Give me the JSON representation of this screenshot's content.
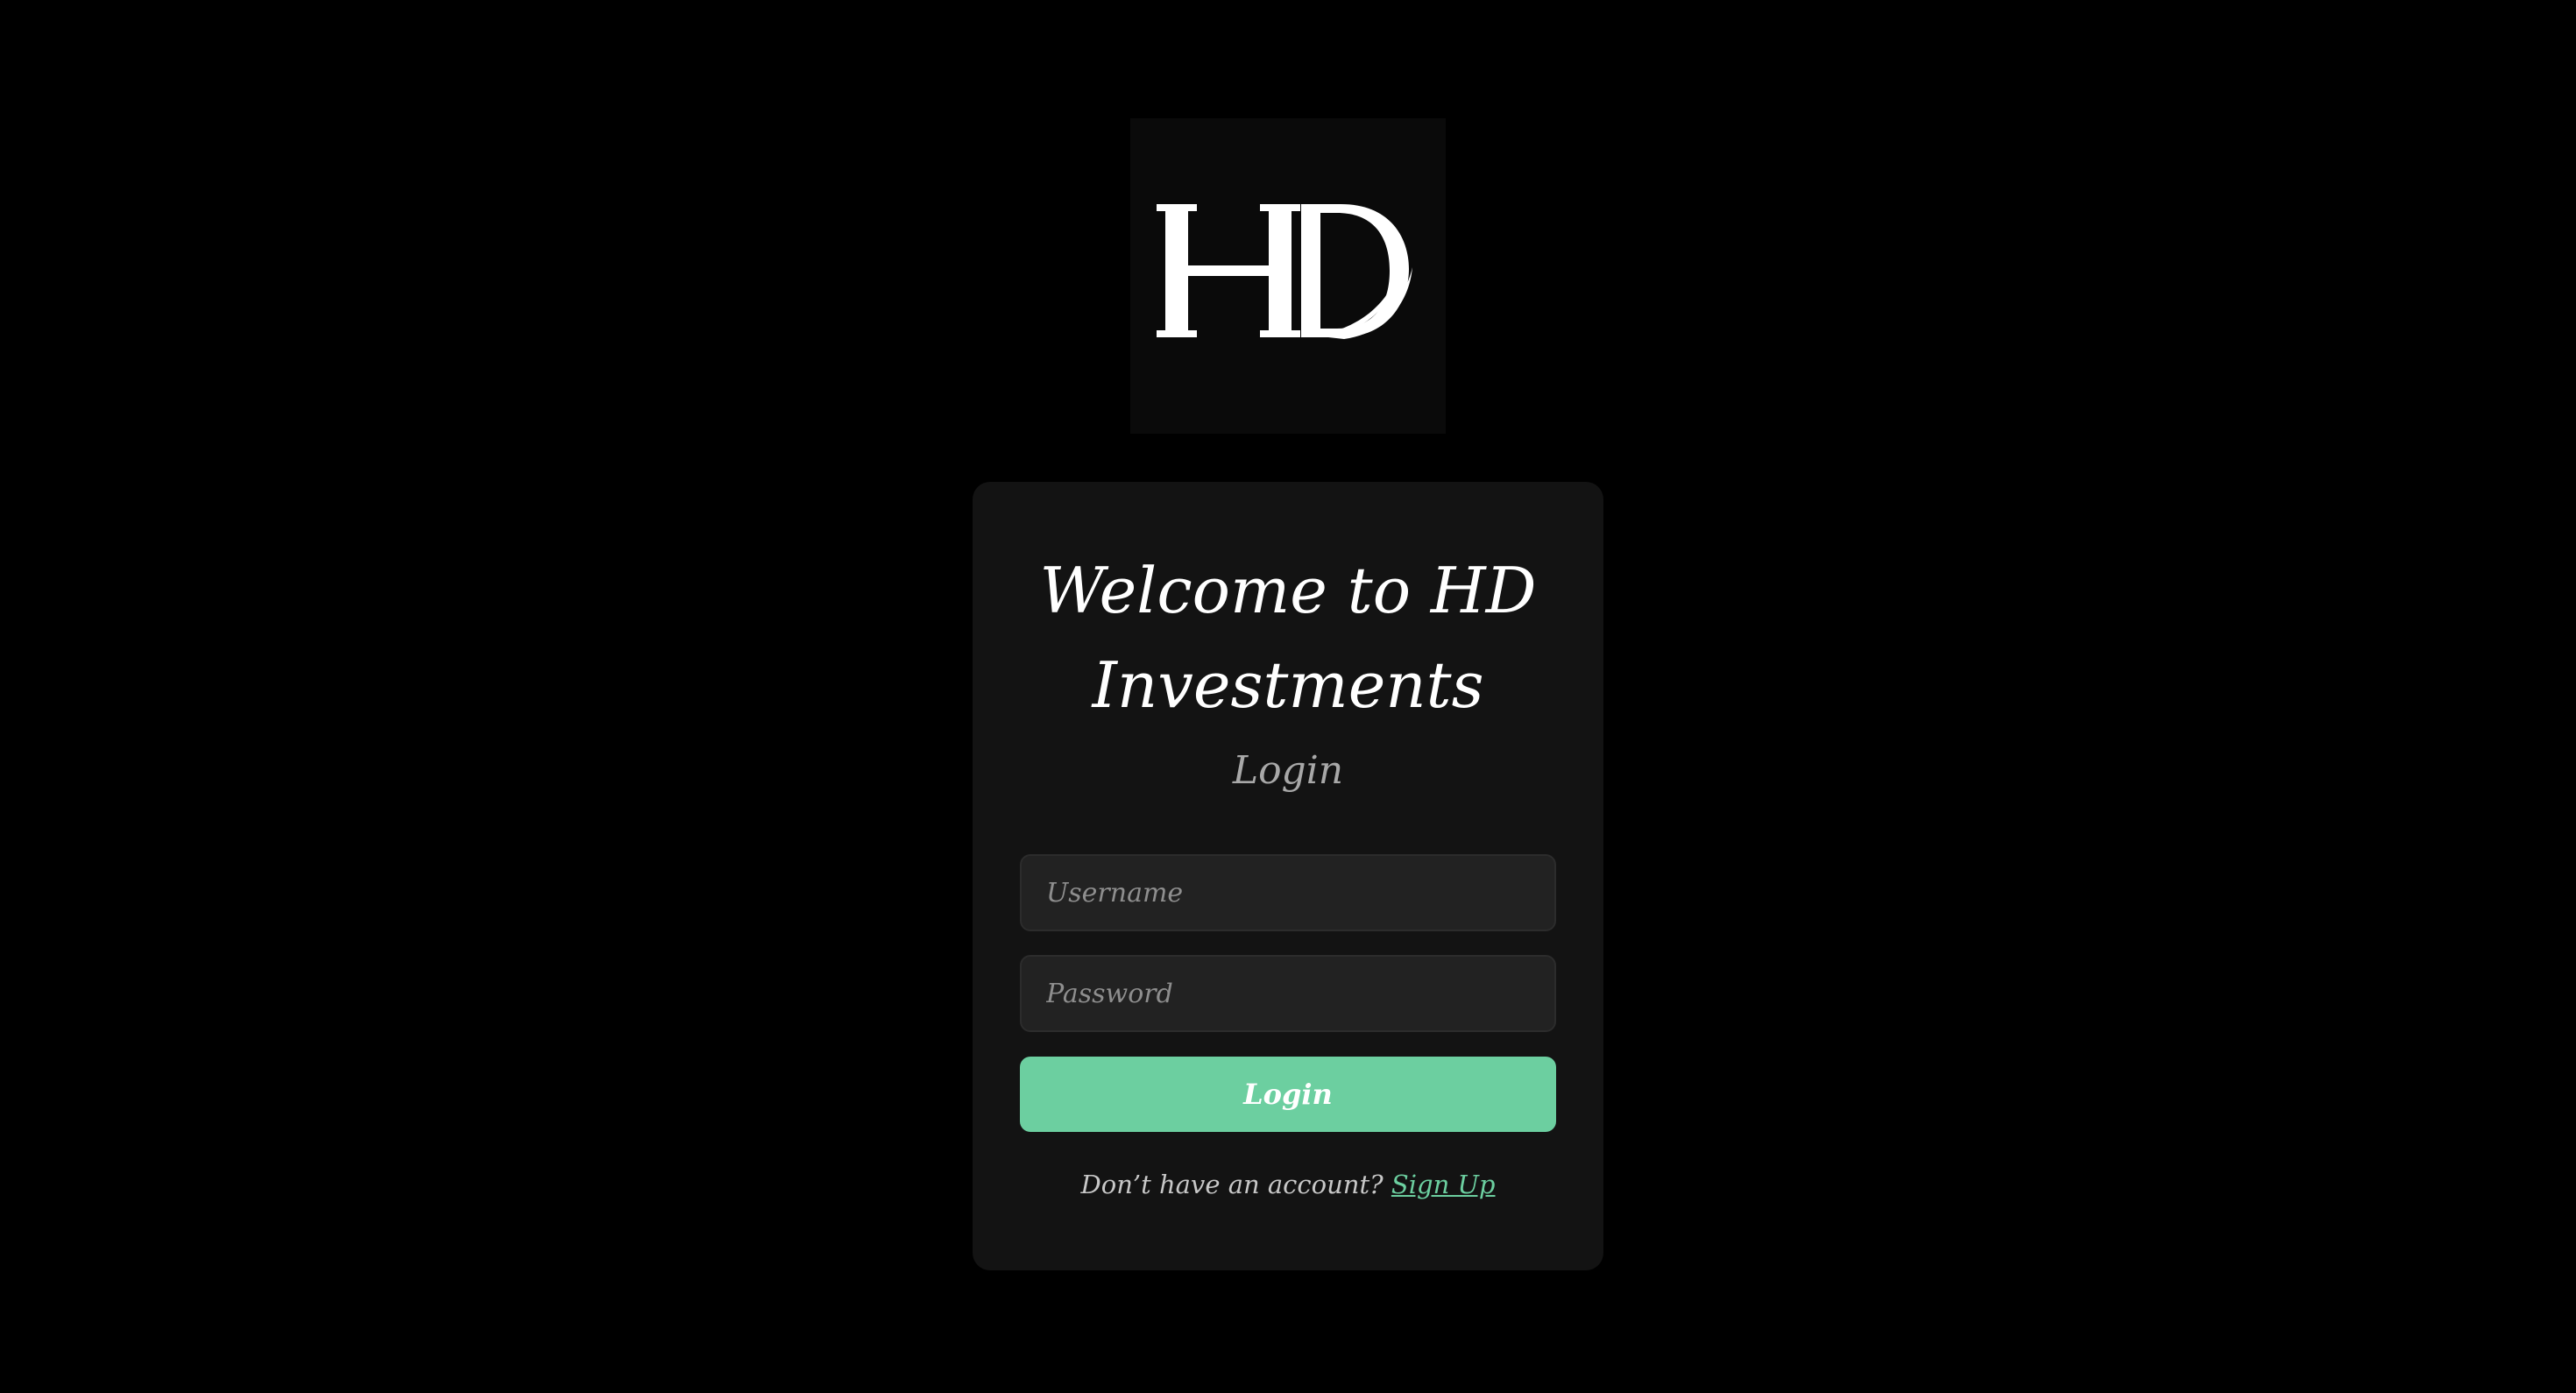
{
  "logo": {
    "text": "HD",
    "background": "#0a0a0a",
    "color": "#ffffff"
  },
  "card": {
    "title": "Welcome to HD Investments",
    "subtitle": "Login",
    "username": {
      "value": "",
      "placeholder": "Username"
    },
    "password": {
      "value": "",
      "placeholder": "Password"
    },
    "login_button": "Login",
    "signup_prompt": "Don’t have an account?",
    "signup_link": "Sign Up"
  },
  "colors": {
    "page_background": "#000000",
    "card_background": "#131313",
    "accent": "#6ccfa0",
    "input_background": "#222222"
  }
}
